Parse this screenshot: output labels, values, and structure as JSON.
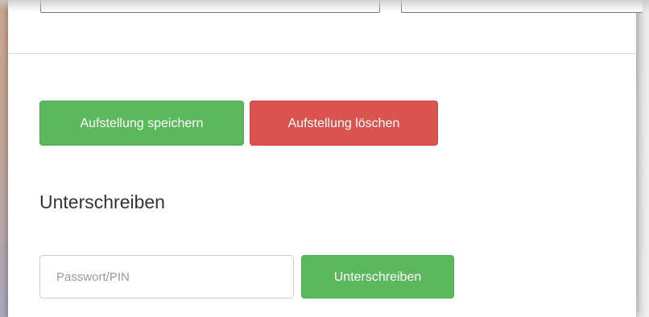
{
  "actions": {
    "save_label": "Aufstellung speichern",
    "delete_label": "Aufstellung löschen"
  },
  "sign_section": {
    "heading": "Unterschreiben",
    "pin_placeholder": "Passwort/PIN",
    "pin_value": "",
    "sign_label": "Unterschreiben"
  },
  "colors": {
    "success": "#5cb85c",
    "danger": "#d9534f",
    "text": "#333333"
  }
}
